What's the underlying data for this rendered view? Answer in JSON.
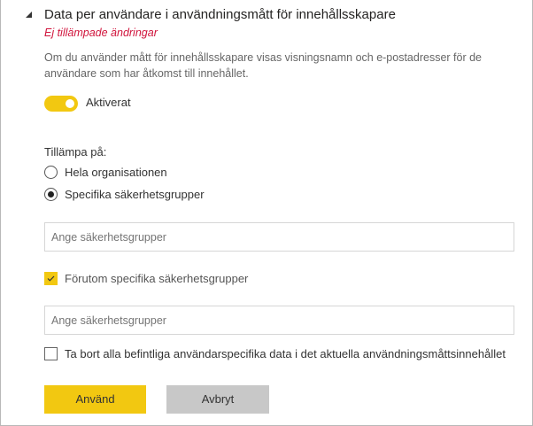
{
  "section": {
    "title": "Data per användare i användningsmått för innehållsskapare",
    "unsaved": "Ej tillämpade ändringar",
    "description": "Om du använder mått för innehållsskapare visas visningsnamn och e-postadresser för de användare som har åtkomst till innehållet.",
    "toggle": {
      "label": "Aktiverat",
      "on": true
    },
    "apply_to": {
      "label": "Tillämpa på:",
      "options": [
        {
          "label": "Hela organisationen",
          "selected": false
        },
        {
          "label": "Specifika säkerhetsgrupper",
          "selected": true
        }
      ]
    },
    "groups_input": {
      "placeholder": "Ange säkerhetsgrupper",
      "value": ""
    },
    "except_checkbox": {
      "label": "Förutom specifika säkerhetsgrupper",
      "checked": true
    },
    "except_input": {
      "placeholder": "Ange säkerhetsgrupper",
      "value": ""
    },
    "delete_checkbox": {
      "label": "Ta bort alla befintliga användarspecifika data i det aktuella användningsmåttsinnehållet",
      "checked": false
    },
    "apply_button": "Använd",
    "cancel_button": "Avbryt"
  },
  "colors": {
    "accent": "#f2c811",
    "warning": "#d0143c",
    "secondary_button": "#c8c8c8"
  }
}
